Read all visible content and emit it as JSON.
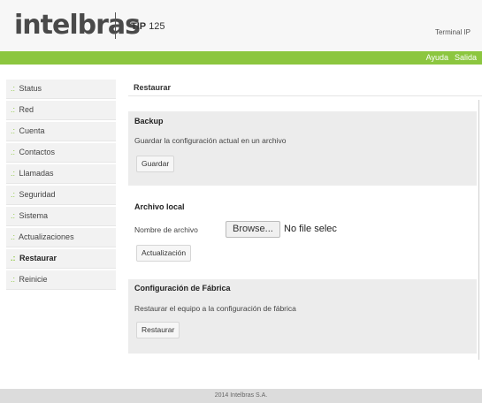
{
  "header": {
    "logo": "intelbras",
    "model_prefix": "TIP",
    "model_number": "125",
    "device_type": "Terminal IP"
  },
  "top_links": {
    "help": "Ayuda",
    "exit": "Salida"
  },
  "sidebar": {
    "bullet": ".:",
    "items": [
      {
        "label": "Status"
      },
      {
        "label": "Red"
      },
      {
        "label": "Cuenta"
      },
      {
        "label": "Contactos"
      },
      {
        "label": "Llamadas"
      },
      {
        "label": "Seguridad"
      },
      {
        "label": "Sistema"
      },
      {
        "label": "Actualizaciones"
      },
      {
        "label": "Restaurar",
        "active": true
      },
      {
        "label": "Reinicie"
      }
    ]
  },
  "main": {
    "title": "Restaurar",
    "backup": {
      "title": "Backup",
      "description": "Guardar la configuración actual en un archivo",
      "button": "Guardar"
    },
    "local_file": {
      "title": "Archivo local",
      "field_label": "Nombre de archivo",
      "browse_button": "Browse...",
      "file_status": "No file selec",
      "button": "Actualización"
    },
    "factory": {
      "title": "Configuración de Fábrica",
      "description": "Restaurar el equipo a la configuración de fábrica",
      "button": "Restaurar"
    }
  },
  "footer": {
    "text": "2014 Intelbras S.A."
  },
  "colors": {
    "accent_green": "#8cc63f",
    "panel_gray": "#ececec"
  }
}
